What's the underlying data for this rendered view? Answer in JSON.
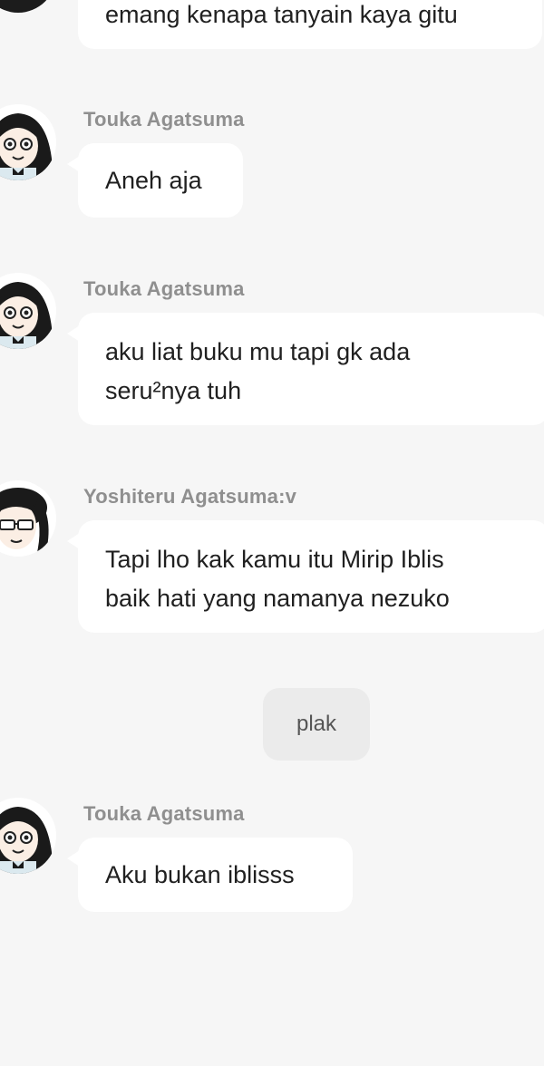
{
  "messages": [
    {
      "sender": "",
      "avatar": "touka-avatar",
      "lines": [
        "emang kenapa tanyain kaya gitu"
      ]
    },
    {
      "sender": "Touka Agatsuma",
      "avatar": "touka-avatar",
      "lines": [
        "Aneh aja"
      ]
    },
    {
      "sender": "Touka Agatsuma",
      "avatar": "touka-avatar",
      "lines": [
        "aku liat buku mu tapi gk ada",
        "seru²nya tuh"
      ]
    },
    {
      "sender": "Yoshiteru Agatsuma:v",
      "avatar": "yoshiteru-avatar",
      "lines": [
        "Tapi lho kak kamu itu Mirip Iblis",
        "baik hati yang namanya nezuko"
      ]
    },
    {
      "sender": "Touka Agatsuma",
      "avatar": "touka-avatar",
      "lines": [
        "Aku bukan iblisss"
      ]
    }
  ],
  "system_message": "plak",
  "colors": {
    "background": "#f6f6f6",
    "bubble": "#ffffff",
    "system_bubble": "#ebebeb",
    "sender_name": "#8f8f8f",
    "text": "#202020"
  }
}
